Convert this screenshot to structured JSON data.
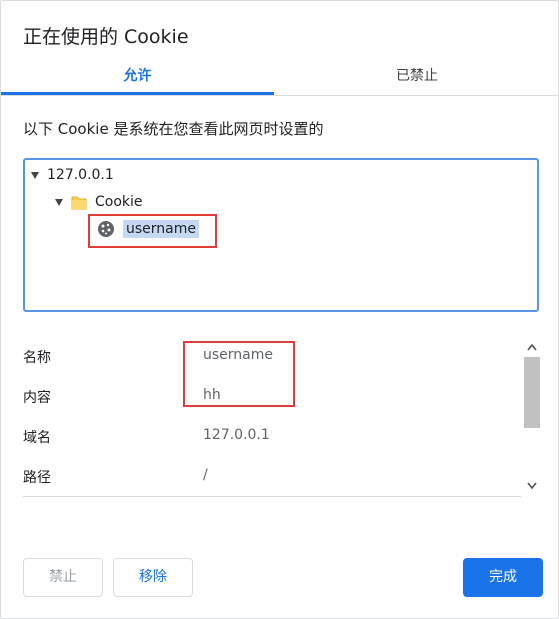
{
  "dialog": {
    "title": "正在使用的 Cookie"
  },
  "tabs": {
    "allowed": "允许",
    "blocked": "已禁止"
  },
  "description": "以下 Cookie 是系统在您查看此网页时设置的",
  "tree": {
    "site": "127.0.0.1",
    "folder": "Cookie",
    "cookie": "username",
    "icons": {
      "expand": "triangle-down-icon",
      "folder": "folder-icon",
      "cookie": "cookie-icon"
    }
  },
  "details": {
    "name_label": "名称",
    "name_value": "username",
    "content_label": "内容",
    "content_value": "hh",
    "domain_label": "域名",
    "domain_value": "127.0.0.1",
    "path_label": "路径",
    "path_value": "/"
  },
  "buttons": {
    "block": "禁止",
    "remove": "移除",
    "done": "完成"
  },
  "colors": {
    "accent": "#1a73e8",
    "highlight": "#e03c3c",
    "selection": "#c5d9f5"
  }
}
